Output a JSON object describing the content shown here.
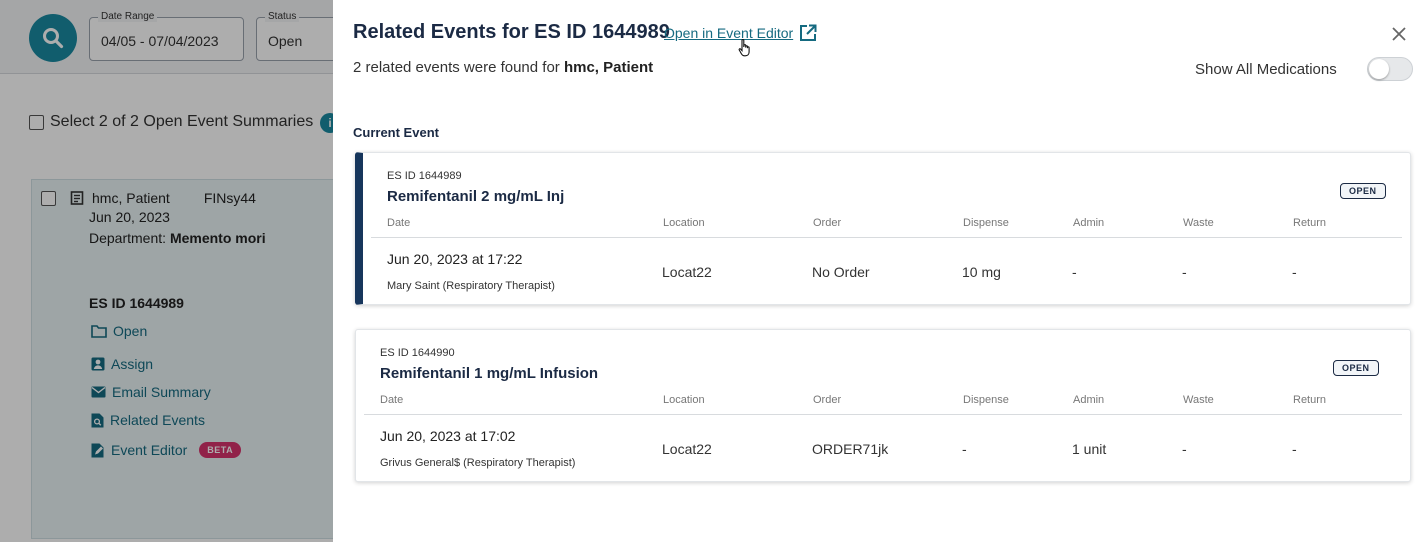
{
  "background": {
    "date_range": {
      "label": "Date Range",
      "value": "04/05 - 07/04/2023"
    },
    "status": {
      "label": "Status",
      "value": "Open"
    },
    "select_all_label": "Select 2 of 2 Open Event Summaries",
    "info_symbol": "i",
    "card": {
      "patient": "hmc, Patient",
      "fin": "FINsy44",
      "date": "Jun 20, 2023",
      "department_label": "Department:",
      "department_value": "Memento mori",
      "es_id": "ES ID 1644989",
      "actions": [
        {
          "label": "Open",
          "icon": "folder-icon"
        },
        {
          "label": "Assign",
          "icon": "assign-icon"
        },
        {
          "label": "Email Summary",
          "icon": "mail-icon"
        },
        {
          "label": "Related Events",
          "icon": "related-doc-icon"
        },
        {
          "label": "Event Editor",
          "icon": "edit-doc-icon"
        }
      ],
      "beta_badge": "BETA"
    }
  },
  "drawer": {
    "title": "Related Events for ES ID 1644989",
    "open_editor_link": "Open in Event Editor",
    "subtitle_prefix": "2 related events were found for",
    "subtitle_patient": "hmc, Patient",
    "show_all_label": "Show All Medications",
    "show_all_on": false,
    "current_section_label": "Current Event",
    "columns": [
      "Date",
      "Location",
      "Order",
      "Dispense",
      "Admin",
      "Waste",
      "Return"
    ],
    "events": [
      {
        "es_id": "ES ID 1644989",
        "medication": "Remifentanil 2 mg/mL Inj",
        "status": "OPEN",
        "date": "Jun 20, 2023 at 17:22",
        "person": "Mary Saint (Respiratory Therapist)",
        "location": "Locat22",
        "order": "No Order",
        "dispense": "10 mg",
        "admin": "-",
        "waste": "-",
        "return": "-"
      },
      {
        "es_id": "ES ID 1644990",
        "medication": "Remifentanil 1 mg/mL Infusion",
        "status": "OPEN",
        "date": "Jun 20, 2023 at 17:02",
        "person": "Grivus General$ (Respiratory Therapist)",
        "location": "Locat22",
        "order": "ORDER71jk",
        "dispense": "-",
        "admin": "1 unit",
        "waste": "-",
        "return": "-"
      }
    ]
  },
  "colors": {
    "accent": "#1a8aa1",
    "navy": "#1b2a44",
    "current_bar": "#17365c",
    "link": "#156a80",
    "beta": "#d6336c"
  }
}
